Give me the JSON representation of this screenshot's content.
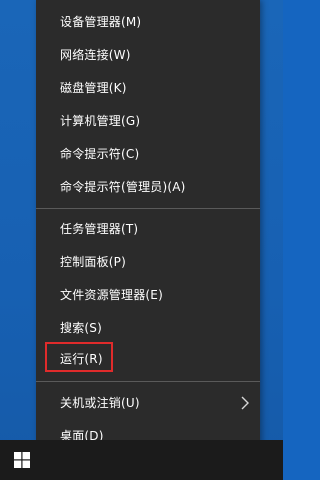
{
  "menu": {
    "items": [
      {
        "label": "设备管理器(M)"
      },
      {
        "label": "网络连接(W)"
      },
      {
        "label": "磁盘管理(K)"
      },
      {
        "label": "计算机管理(G)"
      },
      {
        "label": "命令提示符(C)"
      },
      {
        "label": "命令提示符(管理员)(A)"
      },
      {
        "label": "任务管理器(T)"
      },
      {
        "label": "控制面板(P)"
      },
      {
        "label": "文件资源管理器(E)"
      },
      {
        "label": "搜索(S)"
      },
      {
        "label": "运行(R)"
      },
      {
        "label": "关机或注销(U)"
      },
      {
        "label": "桌面(D)"
      }
    ]
  },
  "colors": {
    "menu_bg": "#2b2b2b",
    "desktop": "#1a66b8",
    "highlight_border": "#e02b2b",
    "taskbar": "#1b1b1b"
  },
  "icons": {
    "submenu": "chevron-right-icon",
    "start": "windows-logo-icon"
  }
}
